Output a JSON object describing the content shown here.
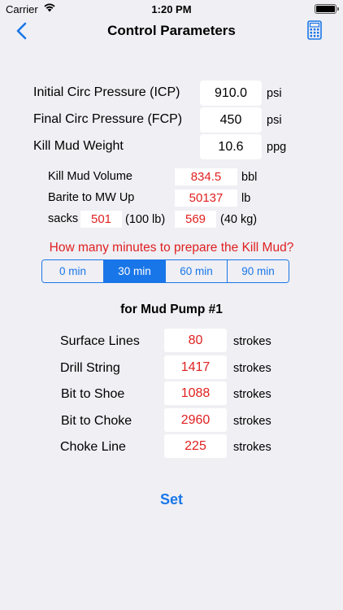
{
  "status": {
    "carrier": "Carrier",
    "time": "1:20 PM"
  },
  "nav": {
    "title": "Control Parameters"
  },
  "params": [
    {
      "label": "Initial Circ Pressure (ICP)",
      "value": "910.0",
      "unit": "psi"
    },
    {
      "label": "Final Circ Pressure (FCP)",
      "value": "450",
      "unit": "psi"
    },
    {
      "label": "Kill Mud Weight",
      "value": "10.6",
      "unit": "ppg"
    }
  ],
  "results": {
    "kill_mud_volume": {
      "label": "Kill Mud Volume",
      "value": "834.5",
      "unit": "bbl"
    },
    "barite": {
      "label": "Barite to MW Up",
      "value": "50137",
      "unit": "lb"
    },
    "sacks": {
      "label": "sacks",
      "value_100": "501",
      "unit_100": "(100 lb)",
      "value_40": "569",
      "unit_40": "(40 kg)"
    }
  },
  "prep_question": "How many minutes to prepare the Kill Mud?",
  "prep_options": [
    "0 min",
    "30 min",
    "60 min",
    "90 min"
  ],
  "prep_selected_index": 1,
  "pump": {
    "title": "for Mud Pump #1",
    "rows": [
      {
        "label": "Surface Lines",
        "value": "80",
        "unit": "strokes"
      },
      {
        "label": "Drill String",
        "value": "1417",
        "unit": "strokes"
      },
      {
        "label": "Bit to Shoe",
        "value": "1088",
        "unit": "strokes"
      },
      {
        "label": "Bit to Choke",
        "value": "2960",
        "unit": "strokes"
      },
      {
        "label": "Choke Line",
        "value": "225",
        "unit": "strokes"
      }
    ]
  },
  "set_label": "Set",
  "colors": {
    "accent": "#1976e8",
    "result_red": "#e02020",
    "background": "#efeff4"
  },
  "icons": {
    "back": "chevron-left-icon",
    "calculator": "calculator-icon",
    "wifi": "wifi-icon",
    "battery": "battery-icon"
  }
}
